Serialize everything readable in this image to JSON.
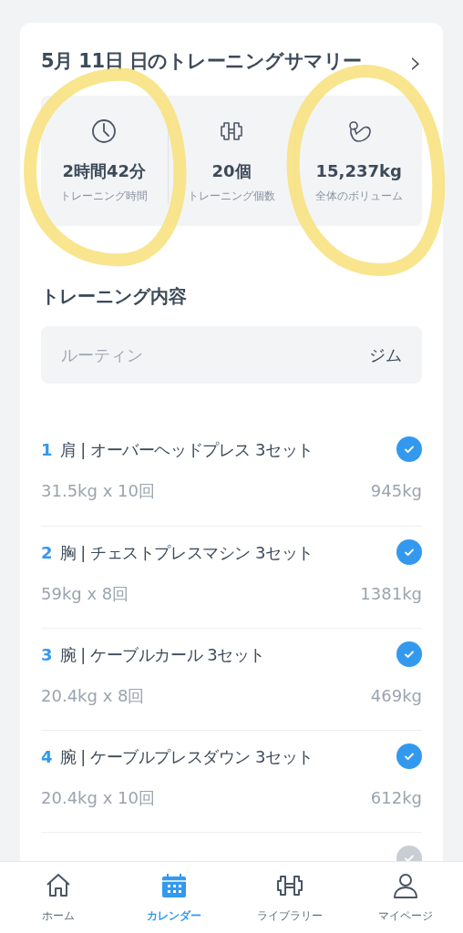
{
  "summary": {
    "title": "5月 11日 日のトレーニングサマリー",
    "chevron": "›",
    "stats": [
      {
        "kind": "time",
        "value": "2時間42分",
        "label": "トレーニング時間"
      },
      {
        "kind": "count",
        "value": "20個",
        "label": "トレーニング個数"
      },
      {
        "kind": "volume",
        "value": "15,237kg",
        "label": "全体のボリューム"
      }
    ]
  },
  "content": {
    "heading": "トレーニング内容",
    "routine": {
      "placeholder": "ルーティン",
      "value": "ジム"
    },
    "exercises": [
      {
        "number": "1",
        "name": "肩 | オーバーヘッドプレス 3セット",
        "detail": "31.5kg x 10回",
        "total": "945kg",
        "checked": true
      },
      {
        "number": "2",
        "name": "胸 | チェストプレスマシン 3セット",
        "detail": "59kg x 8回",
        "total": "1381kg",
        "checked": true
      },
      {
        "number": "3",
        "name": "腕 | ケーブルカール 3セット",
        "detail": "20.4kg x 8回",
        "total": "469kg",
        "checked": true
      },
      {
        "number": "4",
        "name": "腕 | ケーブルプレスダウン 3セット",
        "detail": "20.4kg x 10回",
        "total": "612kg",
        "checked": true
      },
      {
        "checked": false
      }
    ]
  },
  "tab_bar": [
    {
      "kind": "home",
      "label": "ホーム",
      "selected": false
    },
    {
      "kind": "calendar",
      "label": "カレンダー",
      "selected": true
    },
    {
      "kind": "library",
      "label": "ライブラリー",
      "selected": false
    },
    {
      "kind": "mypage",
      "label": "マイページ",
      "selected": false
    }
  ]
}
